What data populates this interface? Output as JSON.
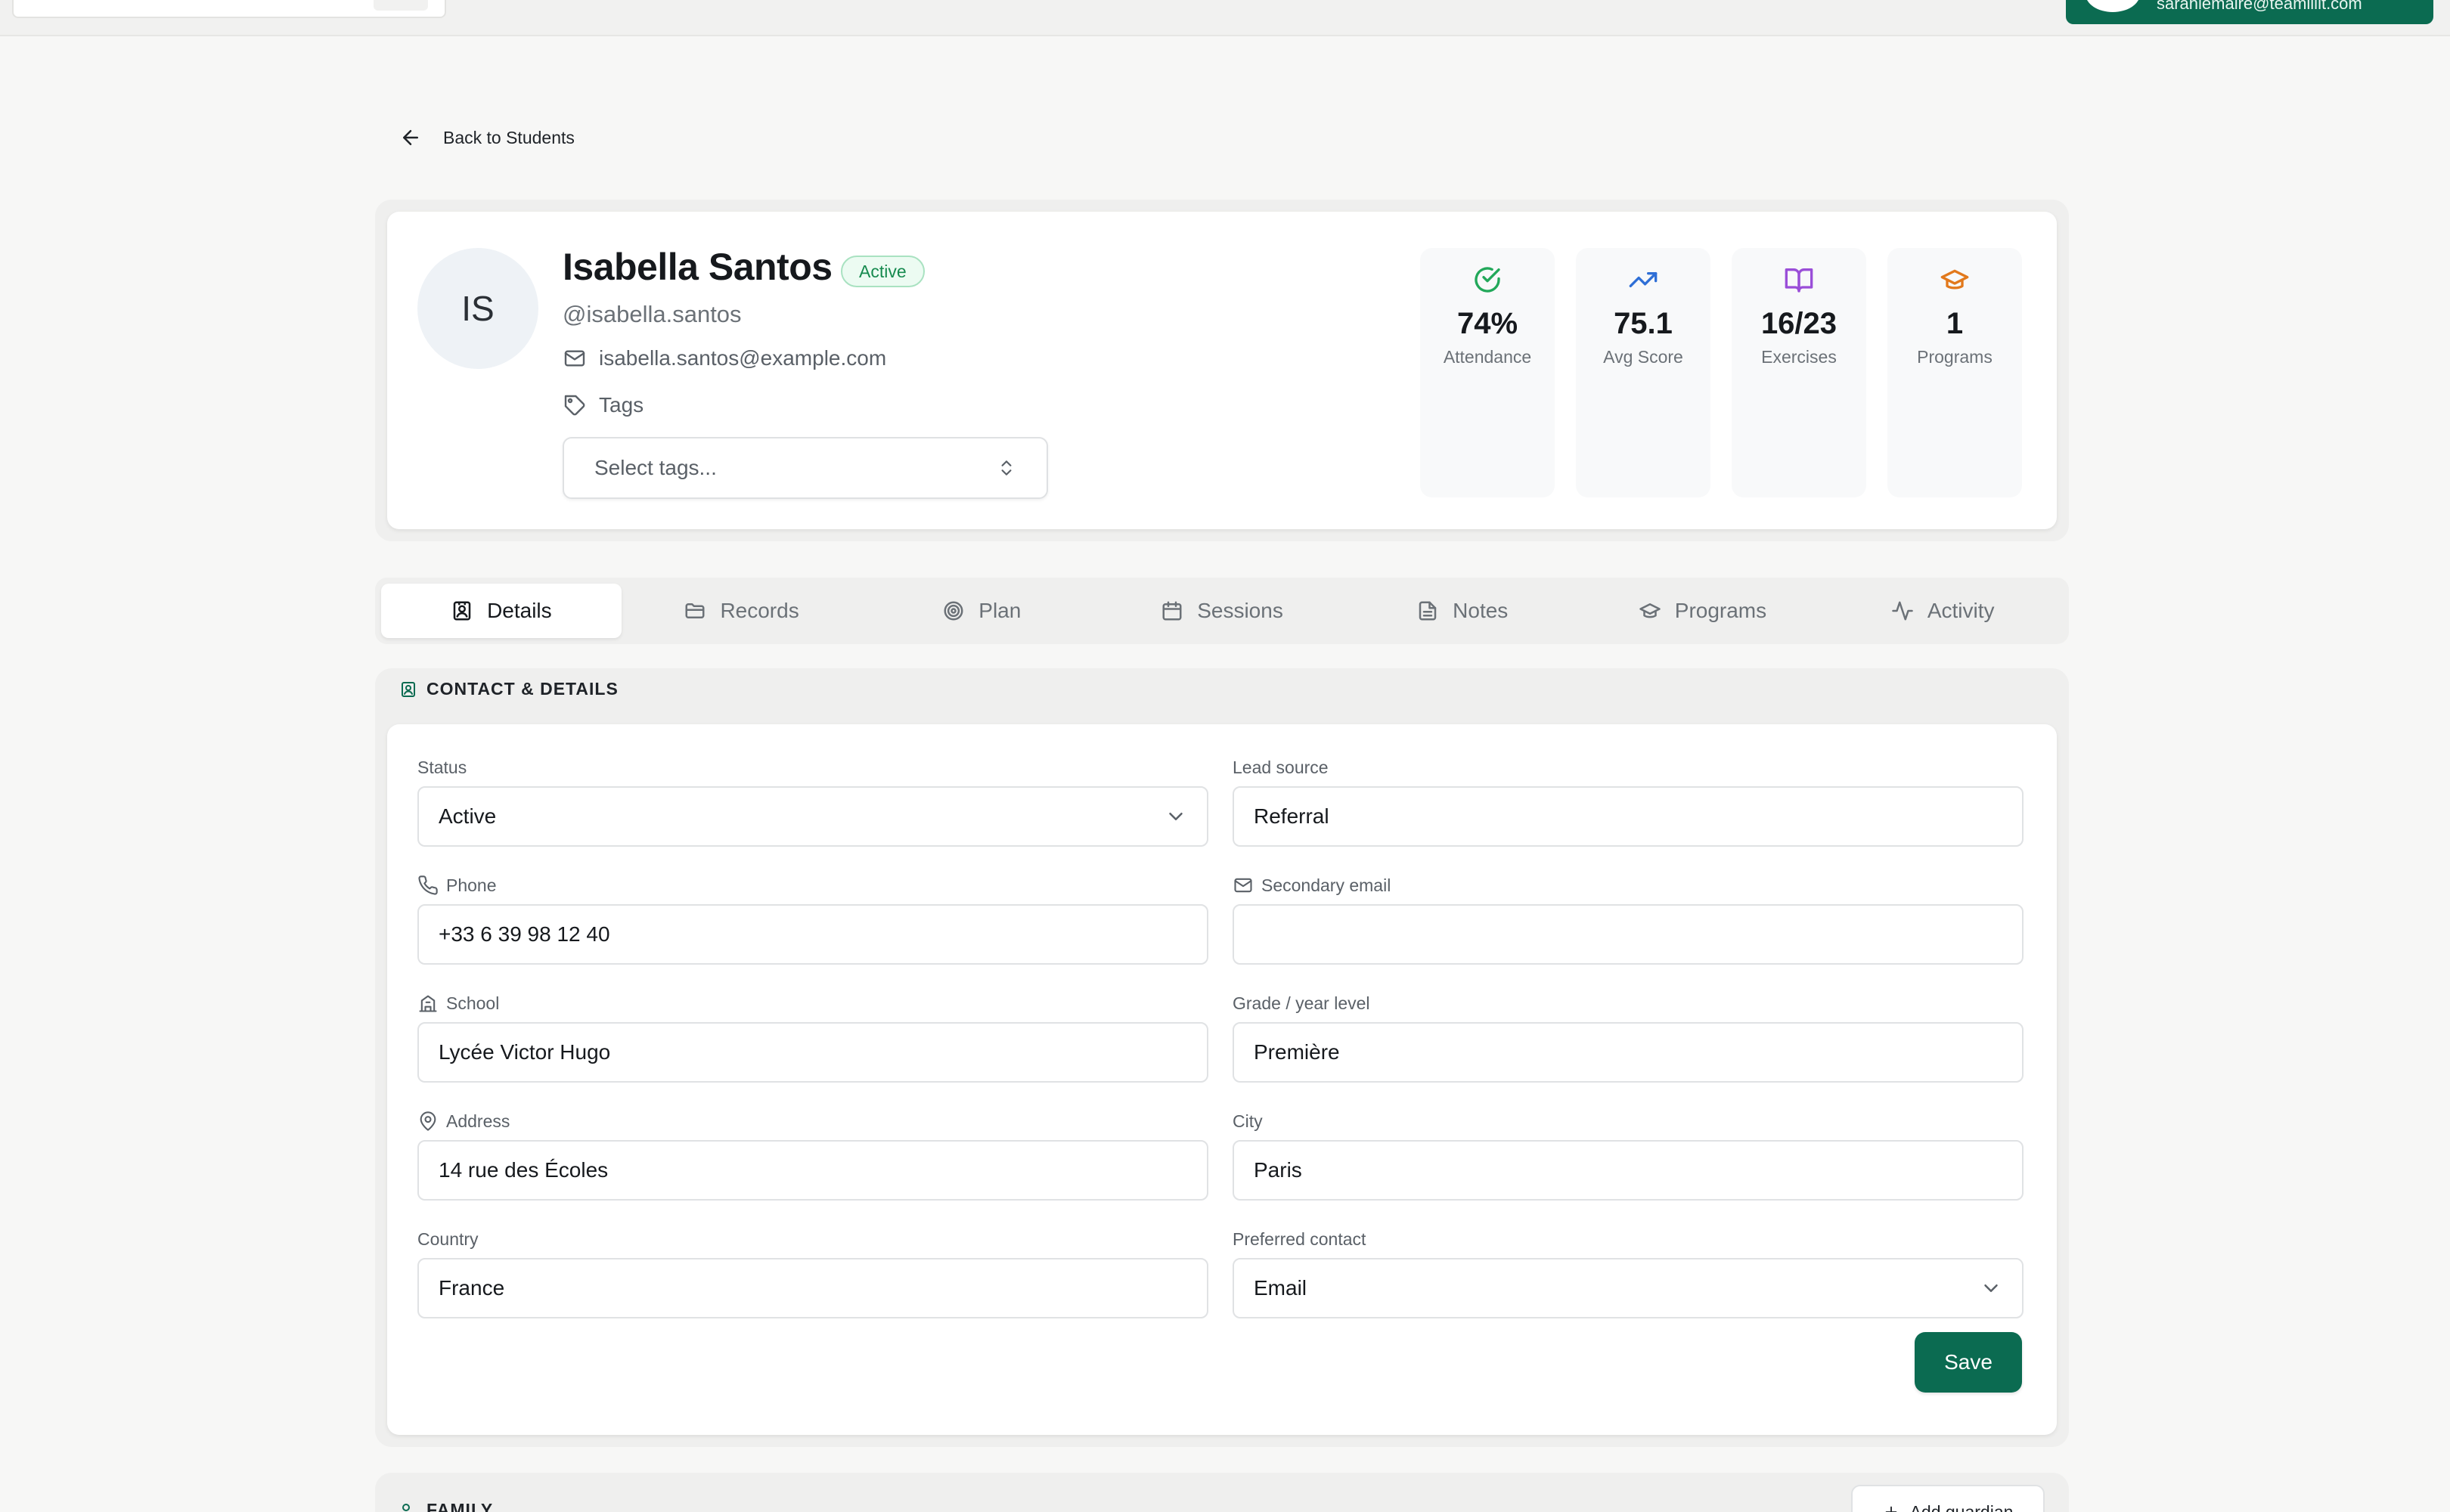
{
  "topbar": {
    "user_email": "sarahlemaire@teamlilit.com"
  },
  "back_link": {
    "label": "Back to Students"
  },
  "student": {
    "initials": "IS",
    "name": "Isabella Santos",
    "status_badge": "Active",
    "handle": "@isabella.santos",
    "email": "isabella.santos@example.com",
    "tags_label": "Tags",
    "tags_placeholder": "Select tags..."
  },
  "stats": [
    {
      "icon": "check-circle-icon",
      "value": "74%",
      "label": "Attendance",
      "color": "#22a85a"
    },
    {
      "icon": "trending-up-icon",
      "value": "75.1",
      "label": "Avg Score",
      "color": "#2f6fd6"
    },
    {
      "icon": "book-open-icon",
      "value": "16/23",
      "label": "Exercises",
      "color": "#9a4ed8"
    },
    {
      "icon": "graduation-cap-icon",
      "value": "1",
      "label": "Programs",
      "color": "#e2791c"
    }
  ],
  "tabs": [
    {
      "label": "Details",
      "icon": "contact-icon",
      "active": true
    },
    {
      "label": "Records",
      "icon": "folder-icon"
    },
    {
      "label": "Plan",
      "icon": "target-icon"
    },
    {
      "label": "Sessions",
      "icon": "calendar-icon"
    },
    {
      "label": "Notes",
      "icon": "file-text-icon"
    },
    {
      "label": "Programs",
      "icon": "graduation-cap-icon"
    },
    {
      "label": "Activity",
      "icon": "activity-icon"
    }
  ],
  "contact": {
    "section_title": "CONTACT & DETAILS",
    "fields": {
      "status": {
        "label": "Status",
        "value": "Active"
      },
      "lead_source": {
        "label": "Lead source",
        "value": "Referral"
      },
      "phone": {
        "label": "Phone",
        "value": "+33 6 39 98 12 40"
      },
      "secondary_email": {
        "label": "Secondary email",
        "value": ""
      },
      "school": {
        "label": "School",
        "value": "Lycée Victor Hugo"
      },
      "grade": {
        "label": "Grade / year level",
        "value": "Première"
      },
      "address": {
        "label": "Address",
        "value": "14 rue des Écoles"
      },
      "city": {
        "label": "City",
        "value": "Paris"
      },
      "country": {
        "label": "Country",
        "value": "France"
      },
      "preferred_contact": {
        "label": "Preferred contact",
        "value": "Email"
      }
    },
    "save_label": "Save"
  },
  "family": {
    "section_title": "FAMILY",
    "add_label": "Add guardian"
  },
  "colors": {
    "brand": "#0b6b51",
    "badge_text": "#168a4f"
  }
}
